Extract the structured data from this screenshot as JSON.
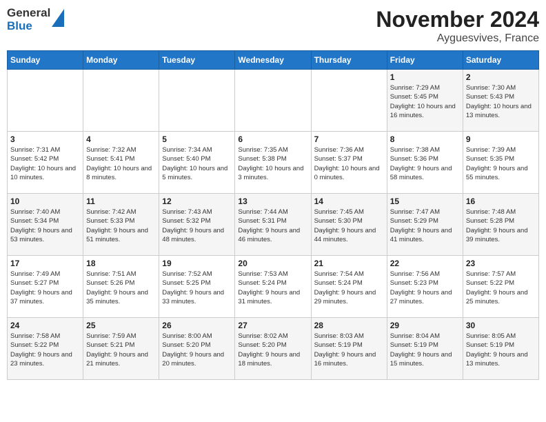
{
  "logo": {
    "line1": "General",
    "line2": "Blue"
  },
  "title": "November 2024",
  "subtitle": "Ayguesvives, France",
  "headers": [
    "Sunday",
    "Monday",
    "Tuesday",
    "Wednesday",
    "Thursday",
    "Friday",
    "Saturday"
  ],
  "weeks": [
    [
      {
        "day": "",
        "info": ""
      },
      {
        "day": "",
        "info": ""
      },
      {
        "day": "",
        "info": ""
      },
      {
        "day": "",
        "info": ""
      },
      {
        "day": "",
        "info": ""
      },
      {
        "day": "1",
        "info": "Sunrise: 7:29 AM\nSunset: 5:45 PM\nDaylight: 10 hours and 16 minutes."
      },
      {
        "day": "2",
        "info": "Sunrise: 7:30 AM\nSunset: 5:43 PM\nDaylight: 10 hours and 13 minutes."
      }
    ],
    [
      {
        "day": "3",
        "info": "Sunrise: 7:31 AM\nSunset: 5:42 PM\nDaylight: 10 hours and 10 minutes."
      },
      {
        "day": "4",
        "info": "Sunrise: 7:32 AM\nSunset: 5:41 PM\nDaylight: 10 hours and 8 minutes."
      },
      {
        "day": "5",
        "info": "Sunrise: 7:34 AM\nSunset: 5:40 PM\nDaylight: 10 hours and 5 minutes."
      },
      {
        "day": "6",
        "info": "Sunrise: 7:35 AM\nSunset: 5:38 PM\nDaylight: 10 hours and 3 minutes."
      },
      {
        "day": "7",
        "info": "Sunrise: 7:36 AM\nSunset: 5:37 PM\nDaylight: 10 hours and 0 minutes."
      },
      {
        "day": "8",
        "info": "Sunrise: 7:38 AM\nSunset: 5:36 PM\nDaylight: 9 hours and 58 minutes."
      },
      {
        "day": "9",
        "info": "Sunrise: 7:39 AM\nSunset: 5:35 PM\nDaylight: 9 hours and 55 minutes."
      }
    ],
    [
      {
        "day": "10",
        "info": "Sunrise: 7:40 AM\nSunset: 5:34 PM\nDaylight: 9 hours and 53 minutes."
      },
      {
        "day": "11",
        "info": "Sunrise: 7:42 AM\nSunset: 5:33 PM\nDaylight: 9 hours and 51 minutes."
      },
      {
        "day": "12",
        "info": "Sunrise: 7:43 AM\nSunset: 5:32 PM\nDaylight: 9 hours and 48 minutes."
      },
      {
        "day": "13",
        "info": "Sunrise: 7:44 AM\nSunset: 5:31 PM\nDaylight: 9 hours and 46 minutes."
      },
      {
        "day": "14",
        "info": "Sunrise: 7:45 AM\nSunset: 5:30 PM\nDaylight: 9 hours and 44 minutes."
      },
      {
        "day": "15",
        "info": "Sunrise: 7:47 AM\nSunset: 5:29 PM\nDaylight: 9 hours and 41 minutes."
      },
      {
        "day": "16",
        "info": "Sunrise: 7:48 AM\nSunset: 5:28 PM\nDaylight: 9 hours and 39 minutes."
      }
    ],
    [
      {
        "day": "17",
        "info": "Sunrise: 7:49 AM\nSunset: 5:27 PM\nDaylight: 9 hours and 37 minutes."
      },
      {
        "day": "18",
        "info": "Sunrise: 7:51 AM\nSunset: 5:26 PM\nDaylight: 9 hours and 35 minutes."
      },
      {
        "day": "19",
        "info": "Sunrise: 7:52 AM\nSunset: 5:25 PM\nDaylight: 9 hours and 33 minutes."
      },
      {
        "day": "20",
        "info": "Sunrise: 7:53 AM\nSunset: 5:24 PM\nDaylight: 9 hours and 31 minutes."
      },
      {
        "day": "21",
        "info": "Sunrise: 7:54 AM\nSunset: 5:24 PM\nDaylight: 9 hours and 29 minutes."
      },
      {
        "day": "22",
        "info": "Sunrise: 7:56 AM\nSunset: 5:23 PM\nDaylight: 9 hours and 27 minutes."
      },
      {
        "day": "23",
        "info": "Sunrise: 7:57 AM\nSunset: 5:22 PM\nDaylight: 9 hours and 25 minutes."
      }
    ],
    [
      {
        "day": "24",
        "info": "Sunrise: 7:58 AM\nSunset: 5:22 PM\nDaylight: 9 hours and 23 minutes."
      },
      {
        "day": "25",
        "info": "Sunrise: 7:59 AM\nSunset: 5:21 PM\nDaylight: 9 hours and 21 minutes."
      },
      {
        "day": "26",
        "info": "Sunrise: 8:00 AM\nSunset: 5:20 PM\nDaylight: 9 hours and 20 minutes."
      },
      {
        "day": "27",
        "info": "Sunrise: 8:02 AM\nSunset: 5:20 PM\nDaylight: 9 hours and 18 minutes."
      },
      {
        "day": "28",
        "info": "Sunrise: 8:03 AM\nSunset: 5:19 PM\nDaylight: 9 hours and 16 minutes."
      },
      {
        "day": "29",
        "info": "Sunrise: 8:04 AM\nSunset: 5:19 PM\nDaylight: 9 hours and 15 minutes."
      },
      {
        "day": "30",
        "info": "Sunrise: 8:05 AM\nSunset: 5:19 PM\nDaylight: 9 hours and 13 minutes."
      }
    ]
  ]
}
